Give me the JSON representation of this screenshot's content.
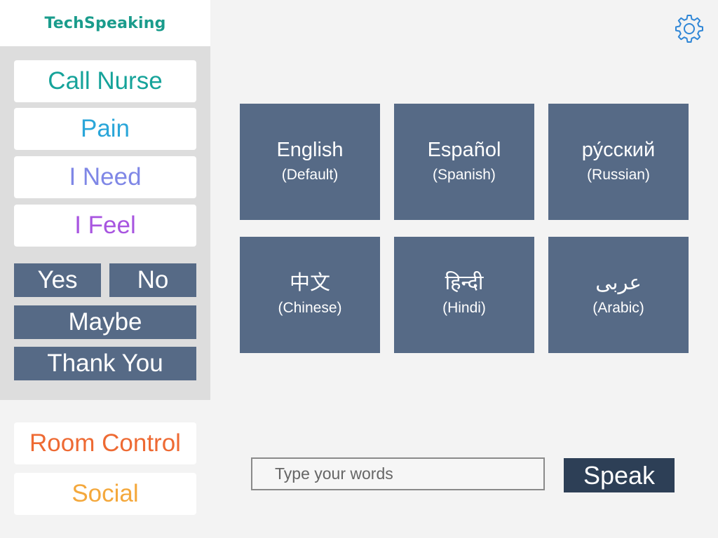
{
  "app": {
    "title": "TechSpeaking"
  },
  "sidebar": {
    "primary": [
      {
        "label": "Call Nurse",
        "color": "#16a39a"
      },
      {
        "label": "Pain",
        "color": "#2aa6d9"
      },
      {
        "label": "I Need",
        "color": "#7f87e6"
      },
      {
        "label": "I Feel",
        "color": "#a855e0"
      }
    ],
    "quick": {
      "yes": "Yes",
      "no": "No",
      "maybe": "Maybe",
      "thank_you": "Thank You"
    },
    "secondary": [
      {
        "label": "Room Control",
        "color": "#ee6a33"
      },
      {
        "label": "Social",
        "color": "#f4a83c"
      }
    ]
  },
  "settings": {
    "icon": "gear-icon",
    "color": "#2f86d6"
  },
  "languages": [
    {
      "name": "English",
      "sub": "(Default)"
    },
    {
      "name": "Español",
      "sub": "(Spanish)"
    },
    {
      "name": "ру́сский",
      "sub": "(Russian)"
    },
    {
      "name": "中文",
      "sub": "(Chinese)"
    },
    {
      "name": "हिन्दी",
      "sub": "(Hindi)"
    },
    {
      "name": "عربى",
      "sub": "(Arabic)"
    }
  ],
  "input": {
    "placeholder": "Type your words",
    "value": ""
  },
  "speak_label": "Speak",
  "colors": {
    "tile": "#566a86",
    "speak": "#2d3f56",
    "panel": "#dddddd",
    "brand": "#1a9c8c"
  }
}
